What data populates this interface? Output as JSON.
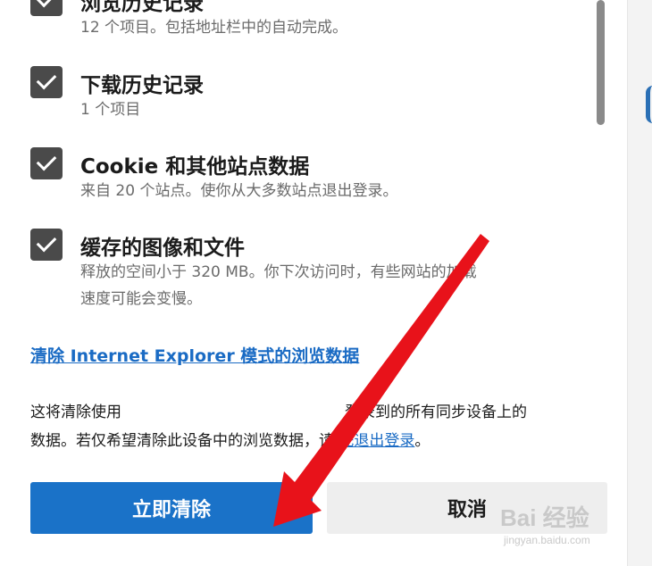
{
  "options": [
    {
      "title": "浏览历史记录",
      "desc": "12 个项目。包括地址栏中的自动完成。",
      "checked": true
    },
    {
      "title": "下载历史记录",
      "desc": "1 个项目",
      "checked": true
    },
    {
      "title": "Cookie 和其他站点数据",
      "desc": "来自 20 个站点。使你从大多数站点退出登录。",
      "checked": true
    },
    {
      "title": "缓存的图像和文件",
      "desc_line1": "释放的空间小于 320 MB。你下次访问时，有些网站的加载",
      "desc_line2": "速度可能会变慢。",
      "checked": true
    }
  ],
  "ie_link": "清除 Internet Explorer 模式的浏览数据",
  "info": {
    "line1_start": "这将清除使用",
    "line1_end": "登录到的所有同步设备上的",
    "line2_start": "数据。若仅希望清除此设备中的浏览数据，请 ",
    "signout_link": "先退出登录",
    "line2_end": "。"
  },
  "buttons": {
    "clear_now": "立即清除",
    "cancel": "取消"
  },
  "watermark": {
    "main": "Bai 经验",
    "sub": "jingyan.baidu.com"
  },
  "colors": {
    "accent": "#1a72c8",
    "link": "#1a6bc4",
    "arrow": "#e8121a"
  }
}
